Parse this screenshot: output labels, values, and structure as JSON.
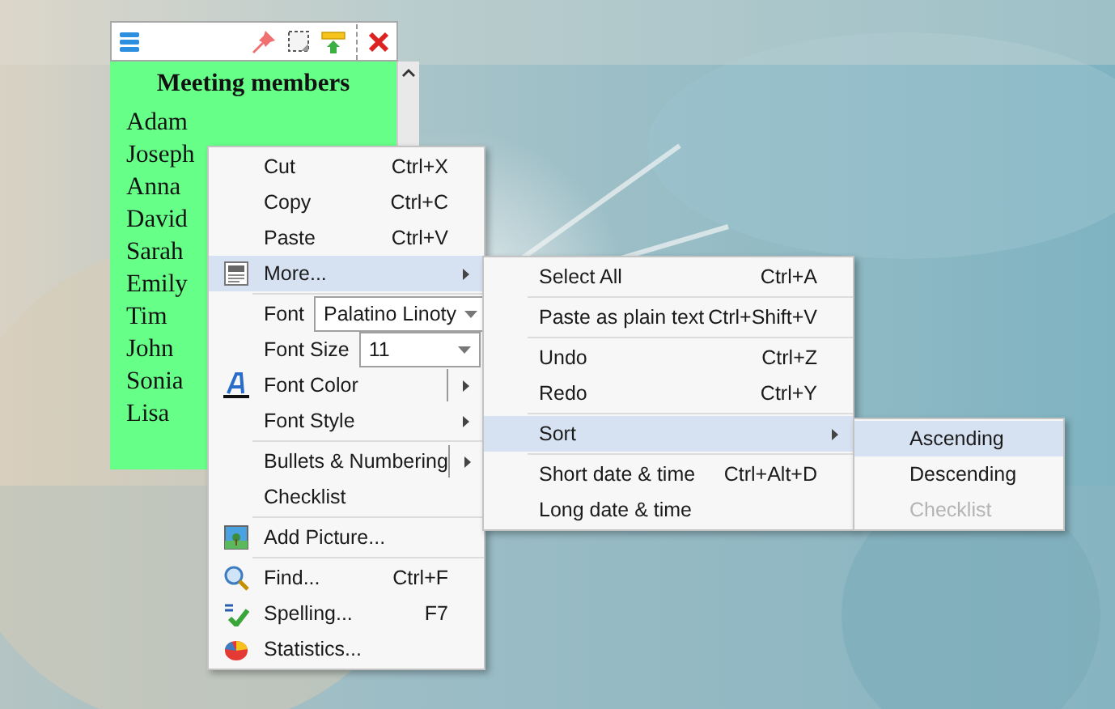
{
  "note": {
    "title": "Meeting members",
    "lines": [
      "Adam",
      "Joseph",
      "Anna",
      "David",
      "Sarah",
      "Emily",
      "Tim",
      "John",
      "Sonia",
      "Lisa"
    ]
  },
  "context_menu": {
    "sections": [
      [
        {
          "kind": "item",
          "label": "Cut",
          "shortcut": "Ctrl+X",
          "selected": false
        },
        {
          "kind": "item",
          "label": "Copy",
          "shortcut": "Ctrl+C",
          "selected": false
        },
        {
          "kind": "item",
          "label": "Paste",
          "shortcut": "Ctrl+V",
          "selected": false
        },
        {
          "kind": "item",
          "label": "More...",
          "submenu": true,
          "selected": true
        }
      ],
      [
        {
          "kind": "combo",
          "label": "Font",
          "value": "Palatino Linoty"
        },
        {
          "kind": "combo",
          "label": "Font Size",
          "value": "11"
        },
        {
          "kind": "item",
          "label": "Font Color",
          "submenu": true,
          "split": true,
          "selected": false
        },
        {
          "kind": "item",
          "label": "Font Style",
          "submenu": true,
          "selected": false
        }
      ],
      [
        {
          "kind": "item",
          "label": "Bullets & Numbering",
          "submenu": true,
          "split": true,
          "selected": false
        },
        {
          "kind": "item",
          "label": "Checklist",
          "selected": false
        }
      ],
      [
        {
          "kind": "item",
          "label": "Add Picture...",
          "selected": false
        }
      ],
      [
        {
          "kind": "item",
          "label": "Find...",
          "shortcut": "Ctrl+F",
          "selected": false
        },
        {
          "kind": "item",
          "label": "Spelling...",
          "shortcut": "F7",
          "selected": false
        },
        {
          "kind": "item",
          "label": "Statistics...",
          "selected": false
        }
      ]
    ]
  },
  "more_menu": {
    "sections": [
      [
        {
          "kind": "item",
          "label": "Select All",
          "shortcut": "Ctrl+A",
          "selected": false
        }
      ],
      [
        {
          "kind": "item",
          "label": "Paste as plain text",
          "shortcut": "Ctrl+Shift+V",
          "selected": false
        }
      ],
      [
        {
          "kind": "item",
          "label": "Undo",
          "shortcut": "Ctrl+Z",
          "selected": false
        },
        {
          "kind": "item",
          "label": "Redo",
          "shortcut": "Ctrl+Y",
          "selected": false
        }
      ],
      [
        {
          "kind": "item",
          "label": "Sort",
          "submenu": true,
          "selected": true
        }
      ],
      [
        {
          "kind": "item",
          "label": "Short date & time",
          "shortcut": "Ctrl+Alt+D",
          "selected": false
        },
        {
          "kind": "item",
          "label": "Long date & time",
          "selected": false
        }
      ]
    ]
  },
  "sort_menu": {
    "sections": [
      [
        {
          "kind": "item",
          "label": "Ascending",
          "selected": true,
          "disabled": false
        },
        {
          "kind": "item",
          "label": "Descending",
          "selected": false,
          "disabled": false
        },
        {
          "kind": "item",
          "label": "Checklist",
          "selected": false,
          "disabled": true
        }
      ]
    ]
  }
}
